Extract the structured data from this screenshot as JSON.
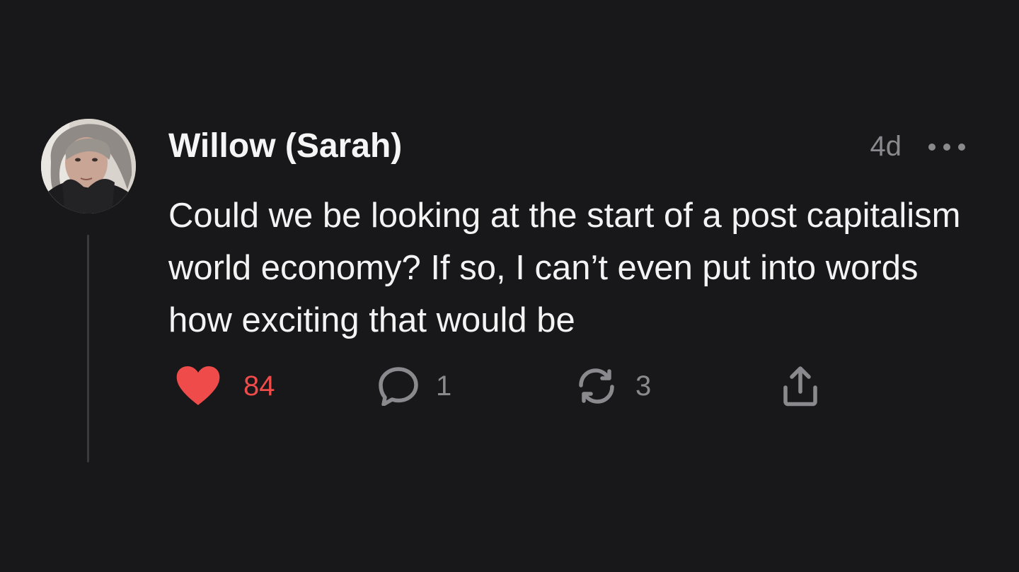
{
  "post": {
    "author": "Willow (Sarah)",
    "time": "4d",
    "text": "Could we be looking at the start of a post capitalism world economy? If so, I can’t even put into words how exciting that would be",
    "stats": {
      "likes": "84",
      "replies": "1",
      "reposts": "3"
    },
    "liked": true
  },
  "icons": {
    "avatar": "user-photo",
    "more": "more-horizontal-icon",
    "like": "heart-icon",
    "reply": "comment-icon",
    "repost": "repost-icon",
    "share": "share-icon"
  },
  "colors": {
    "background": "#18181a",
    "text": "#f3f3f3",
    "muted": "#8a8a8e",
    "like": "#ef4b4b",
    "thread_line": "#3a3a3c"
  }
}
